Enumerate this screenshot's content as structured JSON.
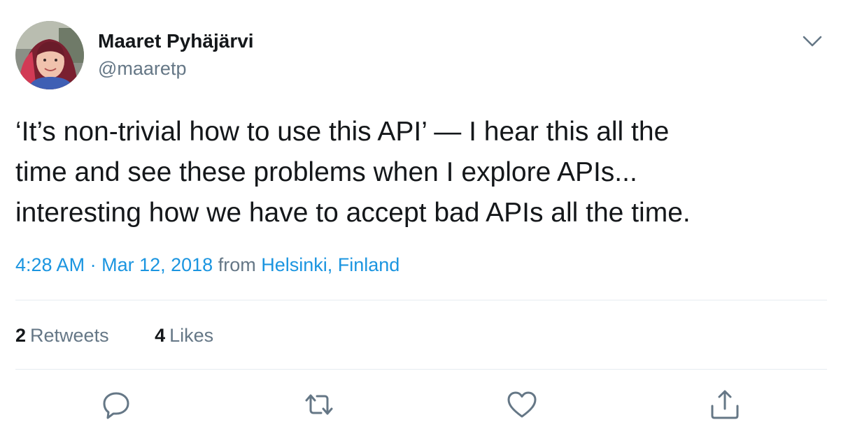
{
  "author": {
    "display_name": "Maaret Pyhäjärvi",
    "handle": "@maaretp",
    "avatar_icon": "profile-photo"
  },
  "tweet": {
    "text_lines": [
      "‘It’s non-trivial how to use this API’ — I hear this all the",
      "time and see these problems when I explore APIs...",
      "interesting how we have to accept bad APIs all the time."
    ],
    "time": "4:28 AM",
    "separator": "·",
    "date": "Mar 12, 2018",
    "from_label": "from",
    "location": "Helsinki, Finland"
  },
  "stats": {
    "retweets_count": "2",
    "retweets_label": "Retweets",
    "likes_count": "4",
    "likes_label": "Likes"
  },
  "actions": {
    "reply_icon": "speech-bubble-icon",
    "retweet_icon": "retweet-arrows-icon",
    "like_icon": "heart-icon",
    "share_icon": "share-upload-icon"
  },
  "colors": {
    "text": "#14171a",
    "secondary": "#657786",
    "link": "#1b95e0",
    "divider": "#e6ecf0"
  }
}
